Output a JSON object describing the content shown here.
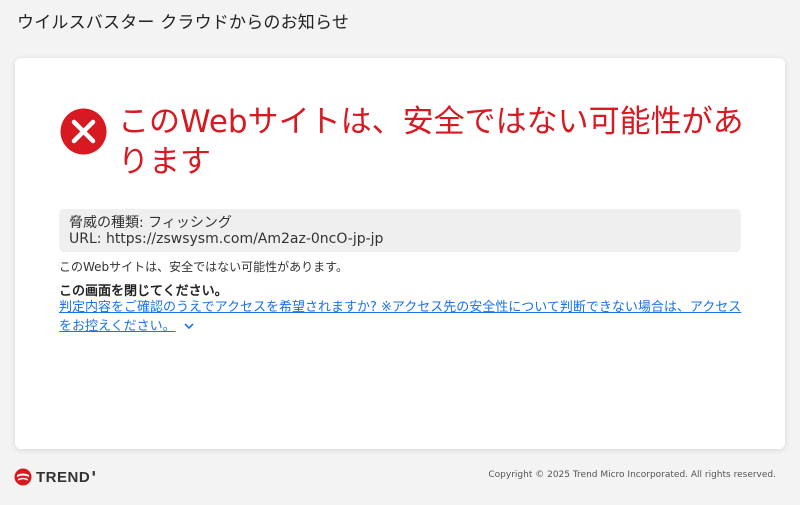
{
  "header": {
    "title": "ウイルスバスター クラウドからのお知らせ"
  },
  "warning": {
    "title": "このWebサイトは、安全ではない可能性があります",
    "icon": "error-x-icon",
    "color": "#d71921"
  },
  "threat": {
    "type_line": "脅威の種類: フィッシング",
    "url_line": "URL: https://zswsysm.com/Am2az-0ncO-jp-jp"
  },
  "description": "このWebサイトは、安全ではない可能性があります。",
  "instruction": "この画面を閉じてください。",
  "proceed_link": "判定内容をご確認のうえでアクセスを希望されますか? ※アクセス先の安全性について判断できない場合は、アクセスをお控えください。",
  "footer": {
    "logo_text": "TREND",
    "copyright": "Copyright © 2025 Trend Micro Incorporated. All rights reserved."
  },
  "colors": {
    "accent_red": "#d71921",
    "link_blue": "#1a73e8"
  }
}
